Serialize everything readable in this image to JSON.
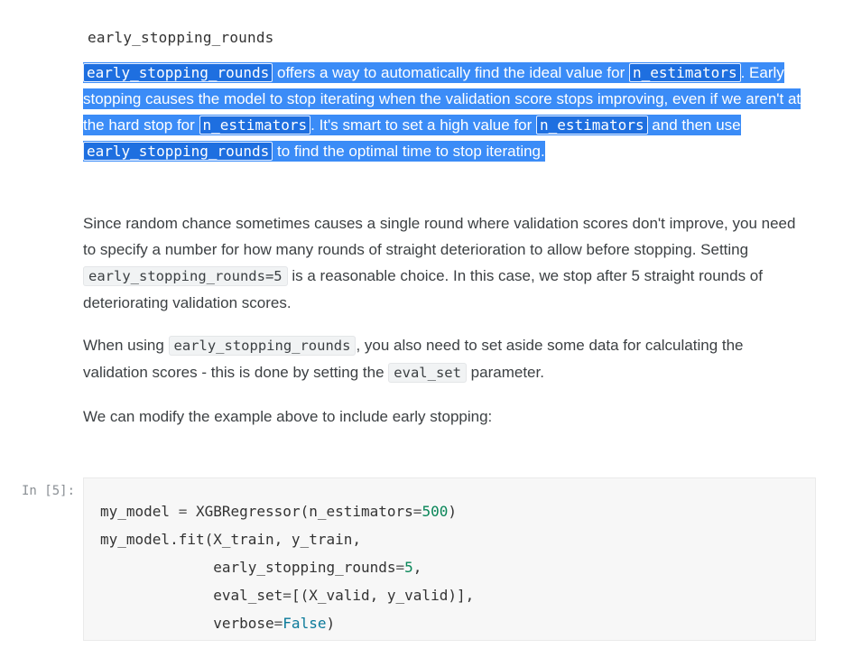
{
  "heading": {
    "code": "early_stopping_rounds"
  },
  "selected_paragraph": {
    "code_early_stopping_rounds": "early_stopping_rounds",
    "t1": " offers a way to automatically find the ideal value for ",
    "code_n_estimators": "n_estimators",
    "t2": ". Early stopping causes the model to stop iterating when the validation score stops improving, even if we aren't at the hard stop for ",
    "t3": ". It's smart to set a high value for ",
    "t4": " and then use ",
    "t5": " to find the optimal time to stop iterating."
  },
  "paragraph2": {
    "t1": "Since random chance sometimes causes a single round where validation scores don't improve, you need to specify a number for how many rounds of straight deterioration to allow before stopping. Setting ",
    "code": "early_stopping_rounds=5",
    "t2": " is a reasonable choice. In this case, we stop after 5 straight rounds of deteriorating validation scores."
  },
  "paragraph3": {
    "t1": "When using ",
    "code1": "early_stopping_rounds",
    "t2": ", you also need to set aside some data for calculating the validation scores - this is done by setting the ",
    "code2": "eval_set",
    "t3": " parameter."
  },
  "paragraph4": {
    "text": "We can modify the example above to include early stopping:"
  },
  "code_cell": {
    "prompt": "In [5]:",
    "l1a": "my_model ",
    "l1b": "=",
    "l1c": " XGBRegressor(n_estimators",
    "l1d": "=",
    "l1e": "500",
    "l1f": ")",
    "l2": "my_model.fit(X_train, y_train,",
    "l3a": "             early_stopping_rounds",
    "l3b": "=",
    "l3c": "5",
    "l3d": ",",
    "l4a": "             eval_set",
    "l4b": "=",
    "l4c": "[(X_valid, y_valid)],",
    "l5a": "             verbose",
    "l5b": "=",
    "l5c": "False",
    "l5d": ")"
  }
}
